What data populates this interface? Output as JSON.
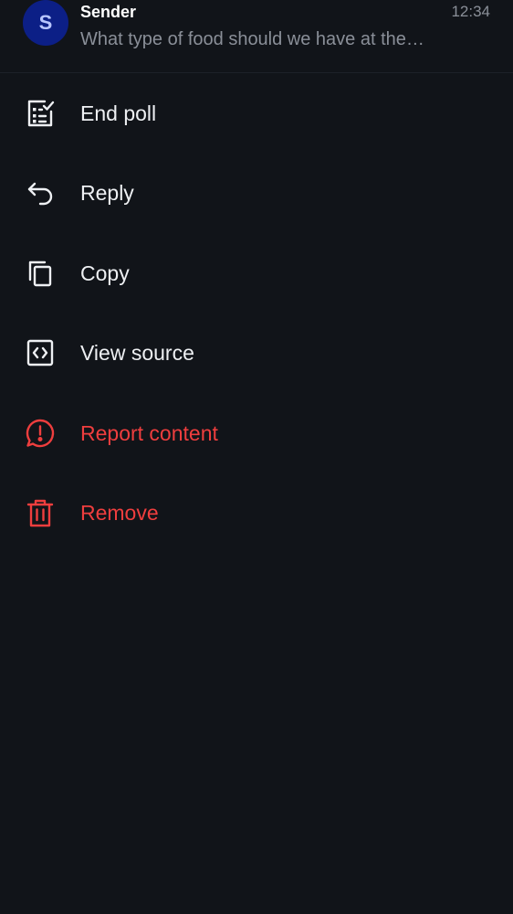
{
  "event": {
    "avatar_letter": "S",
    "sender": "Sender",
    "preview": "What type of food should we have at the party?",
    "time": "12:34"
  },
  "menu": {
    "items": [
      {
        "label": "End poll",
        "icon": "end-poll-icon"
      },
      {
        "label": "Reply",
        "icon": "reply-icon"
      },
      {
        "label": "Copy",
        "icon": "copy-icon"
      },
      {
        "label": "View source",
        "icon": "code-icon"
      },
      {
        "label": "Report content",
        "icon": "report-icon"
      },
      {
        "label": "Remove",
        "icon": "trash-icon"
      }
    ]
  },
  "colors": {
    "background": "#111419",
    "avatar": "#0c1f86",
    "text": "#eef0f3",
    "muted": "#8a8f98",
    "danger": "#ef3e3e"
  }
}
